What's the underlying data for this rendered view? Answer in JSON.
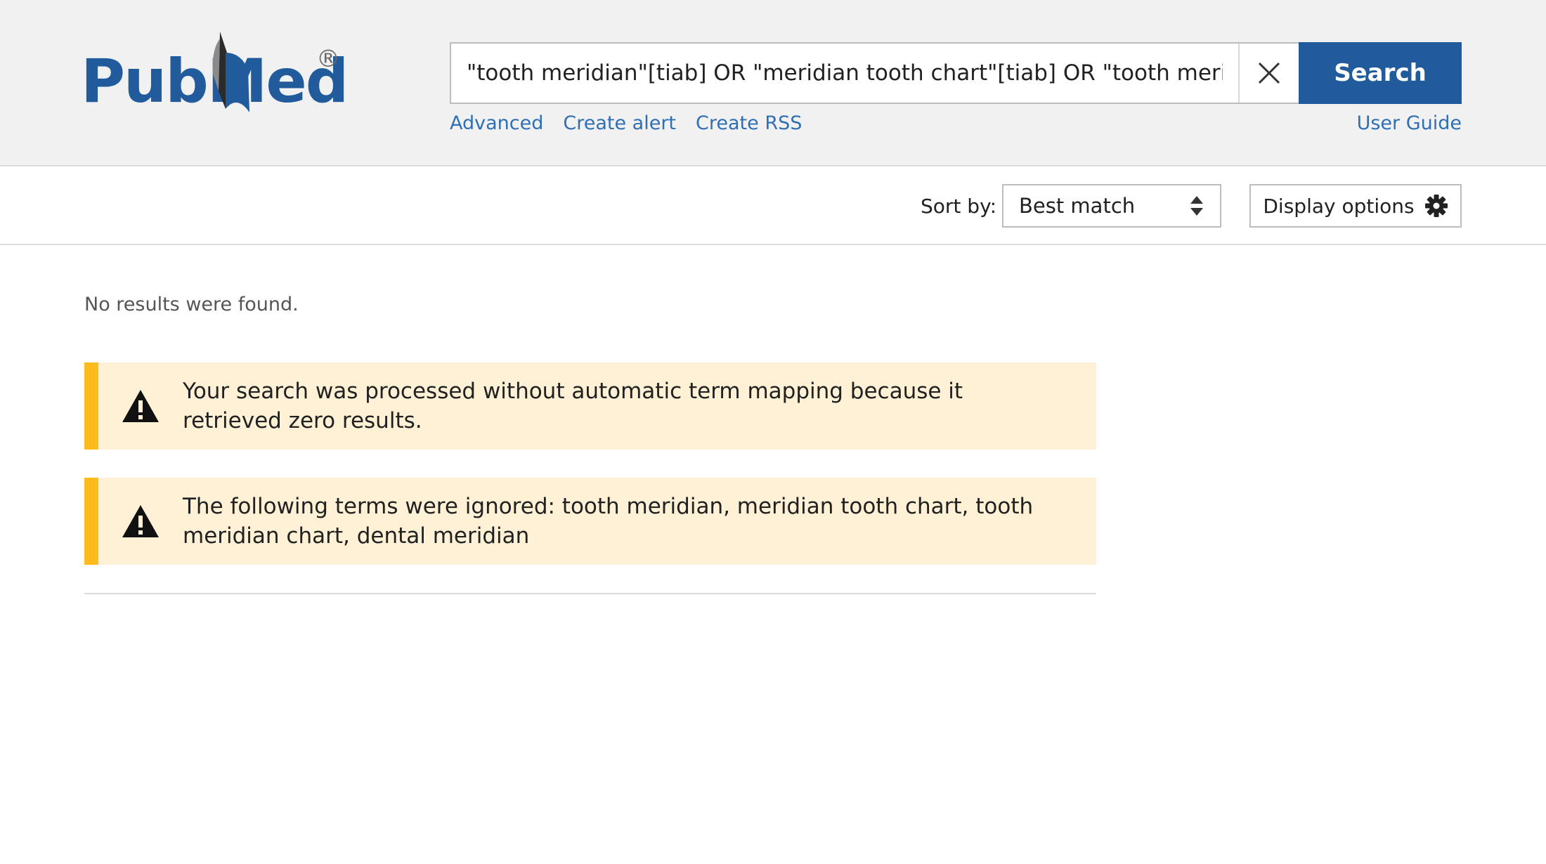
{
  "header": {
    "logo_text": "PubMed",
    "logo_registered": "®",
    "search": {
      "value": "\"tooth meridian\"[tiab] OR \"meridian tooth chart\"[tiab] OR \"tooth meridian ch",
      "button_label": "Search"
    },
    "links": {
      "advanced": "Advanced",
      "create_alert": "Create alert",
      "create_rss": "Create RSS",
      "user_guide": "User Guide"
    }
  },
  "toolbar": {
    "sort_label": "Sort by:",
    "sort_value": "Best match",
    "display_options": "Display options"
  },
  "results": {
    "no_results": "No results were found.",
    "alerts": [
      {
        "text": "Your search was processed without automatic term mapping because it retrieved zero results."
      },
      {
        "text": "The following terms were ignored: tooth meridian, meridian tooth chart, tooth meridian chart, dental meridian"
      }
    ]
  },
  "colors": {
    "brand_blue": "#215b9b",
    "link_blue": "#2e6fb5",
    "alert_bg": "#fef1d5",
    "alert_accent": "#ffbb1c",
    "header_bg": "#f1f1f1"
  },
  "icons": {
    "clear": "close-icon",
    "sort": "sort-arrows-icon",
    "display": "gear-icon",
    "alert": "warning-icon"
  }
}
